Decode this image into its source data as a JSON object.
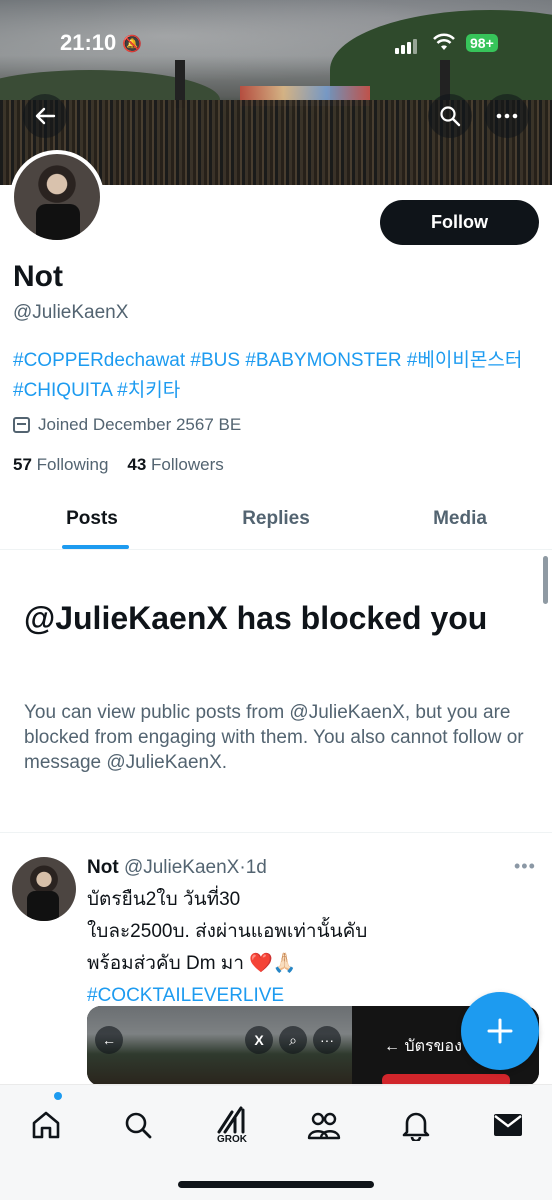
{
  "status_bar": {
    "time": "21:10",
    "battery": "98+"
  },
  "profile": {
    "display_name": "Not",
    "handle": "@JulieKaenX",
    "follow_label": "Follow",
    "bio": "#COPPERdechawat #BUS #BABYMONSTER #베이비몬스터 #CHIQUITA #치키타",
    "joined": "Joined December 2567 BE",
    "following_count": "57",
    "following_label": "Following",
    "followers_count": "43",
    "followers_label": "Followers"
  },
  "tabs": [
    {
      "label": "Posts",
      "active": true
    },
    {
      "label": "Replies",
      "active": false
    },
    {
      "label": "Media",
      "active": false
    }
  ],
  "blocked_notice": {
    "title": "@JulieKaenX has blocked you",
    "body": "You can view public posts from @JulieKaenX, but you are blocked from engaging with them. You also cannot follow or message @JulieKaenX."
  },
  "post": {
    "name": "Not",
    "handle": "@JulieKaenX",
    "separator": "·",
    "time": "1d",
    "line1": "บัตรยืน2ใบ วันที่30",
    "line2": "ใบละ2500บ. ส่งผ่านแอพเท่านั้นคับ",
    "line3": "พร้อมส่วคับ Dm มา ❤️🙏🏻",
    "hashtag": "#COCKTAILEVERLIVE",
    "media_label": "บัตรของ"
  },
  "bottom_nav": {
    "grok_label": "GROK",
    "items": [
      "home",
      "search",
      "grok",
      "communities",
      "notifications",
      "messages"
    ]
  },
  "colors": {
    "accent": "#1d9bf0",
    "text": "#0f1419",
    "muted": "#536471"
  }
}
